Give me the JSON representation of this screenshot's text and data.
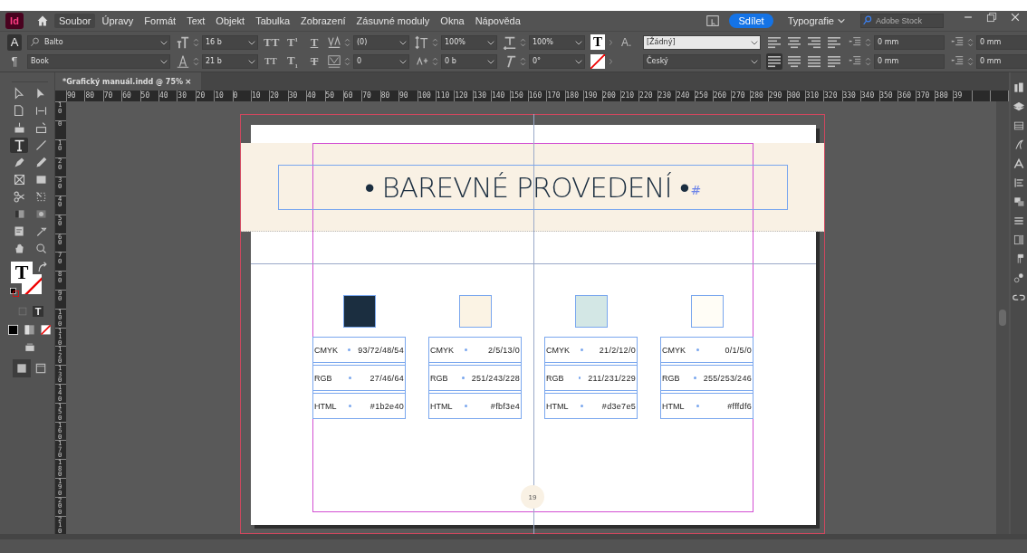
{
  "app": {
    "logo": "Id"
  },
  "menu": [
    {
      "label": "Soubor",
      "selected": true
    },
    {
      "label": "Úpravy",
      "selected": false
    },
    {
      "label": "Formát",
      "selected": false
    },
    {
      "label": "Text",
      "selected": false
    },
    {
      "label": "Objekt",
      "selected": false
    },
    {
      "label": "Tabulka",
      "selected": false
    },
    {
      "label": "Zobrazení",
      "selected": false
    },
    {
      "label": "Zásuvné moduly",
      "selected": false
    },
    {
      "label": "Okna",
      "selected": false
    },
    {
      "label": "Nápověda",
      "selected": false
    }
  ],
  "header_right": {
    "share": "Sdílet",
    "workspace": "Typografie",
    "search_placeholder": "Adobe Stock"
  },
  "control_panel": {
    "modes": [
      {
        "label": "A",
        "selected": true
      },
      {
        "label": "¶",
        "selected": false
      }
    ],
    "font_family": "Balto",
    "font_style": "Book",
    "font_size": "16 b",
    "leading": "21 b",
    "style_rows": [
      [
        {
          "label": "TT",
          "kind": "plain"
        },
        {
          "label": "T$^{1}$",
          "kind": "plain"
        },
        {
          "label": "T",
          "kind": "underline"
        }
      ],
      [
        {
          "label": "TT",
          "kind": "smallcaps"
        },
        {
          "label": "T$_{1}$",
          "kind": "plain"
        },
        {
          "label": "T",
          "kind": "strike"
        }
      ]
    ],
    "fields": [
      [
        {
          "kind": "kerning",
          "value": "(0)"
        },
        {
          "kind": "vscale",
          "value": "100%"
        },
        {
          "kind": "hscale",
          "value": "100%"
        }
      ],
      [
        {
          "kind": "tracking",
          "value": "0"
        },
        {
          "kind": "baseline",
          "value": "0 b"
        },
        {
          "kind": "skew",
          "value": "0°"
        }
      ]
    ],
    "char_style_label": "A.",
    "char_style": "[Žádný]",
    "language": "Český",
    "align": [
      {
        "kind": "left",
        "selected": false
      },
      {
        "kind": "center",
        "selected": false
      },
      {
        "kind": "right",
        "selected": false
      },
      {
        "kind": "towardspine",
        "selected": false
      },
      {
        "kind": "justify-left",
        "selected": true
      },
      {
        "kind": "justify-center",
        "selected": false
      },
      {
        "kind": "justify-all",
        "selected": false
      },
      {
        "kind": "awayspine",
        "selected": false
      }
    ],
    "indents": [
      [
        "0 mm",
        "0 mm"
      ],
      [
        "0 mm",
        "0 mm"
      ]
    ]
  },
  "document_tab": {
    "title": "*Grafický manuál.indd @ 75%",
    "close": "×"
  },
  "ruler_h": [
    "90",
    "80",
    "70",
    "60",
    "50",
    "40",
    "30",
    "20",
    "10",
    "0",
    "10",
    "20",
    "30",
    "40",
    "50",
    "60",
    "70",
    "80",
    "90",
    "100",
    "110",
    "120",
    "130",
    "140",
    "150",
    "160",
    "170",
    "180",
    "190",
    "200",
    "210",
    "220",
    "230",
    "240",
    "250",
    "260",
    "270",
    "280",
    "290",
    "300",
    "310",
    "320",
    "330",
    "340",
    "350",
    "360",
    "370",
    "380",
    "39"
  ],
  "ruler_v": [
    "10",
    "0",
    "10",
    "20",
    "30",
    "40",
    "50",
    "60",
    "70",
    "80",
    "90",
    "100",
    "110",
    "120",
    "130",
    "140",
    "150",
    "160",
    "170",
    "180",
    "190",
    "200",
    "210"
  ],
  "tools": [
    {
      "kind": "select",
      "selected": false
    },
    {
      "kind": "direct",
      "selected": false
    },
    {
      "kind": "page",
      "selected": false
    },
    {
      "kind": "gap",
      "selected": false
    },
    {
      "kind": "collect",
      "selected": false
    },
    {
      "kind": "place",
      "selected": false
    },
    {
      "kind": "type",
      "selected": true
    },
    {
      "kind": "line",
      "selected": false
    },
    {
      "kind": "pen",
      "selected": false
    },
    {
      "kind": "pencil",
      "selected": false
    },
    {
      "kind": "frame",
      "selected": false
    },
    {
      "kind": "rect",
      "selected": false
    },
    {
      "kind": "scissors",
      "selected": false
    },
    {
      "kind": "transform",
      "selected": false
    },
    {
      "kind": "gradient",
      "selected": false
    },
    {
      "kind": "feather",
      "selected": false
    },
    {
      "kind": "note",
      "selected": false
    },
    {
      "kind": "eyedropper",
      "selected": false
    },
    {
      "kind": "hand",
      "selected": false
    },
    {
      "kind": "zoom",
      "selected": false
    }
  ],
  "fill_stroke": {
    "fill_label": "T",
    "toolbox_fill_label": "T",
    "formatting_label": "T"
  },
  "page": {
    "title": "• BAREVNÉ PROVEDENÍ •",
    "end_mark": "#",
    "page_number": "19",
    "swatches": [
      {
        "color": "#1b2e40",
        "rows": [
          {
            "label": "CMYK",
            "value": "93/72/48/54"
          },
          {
            "label": "RGB",
            "value": "27/46/64"
          },
          {
            "label": "HTML",
            "value": "#1b2e40"
          }
        ]
      },
      {
        "color": "#fbf3e4",
        "rows": [
          {
            "label": "CMYK",
            "value": "2/5/13/0"
          },
          {
            "label": "RGB",
            "value": "251/243/228"
          },
          {
            "label": "HTML",
            "value": "#fbf3e4"
          }
        ]
      },
      {
        "color": "#d3e7e5",
        "rows": [
          {
            "label": "CMYK",
            "value": "21/2/12/0"
          },
          {
            "label": "RGB",
            "value": "211/231/229"
          },
          {
            "label": "HTML",
            "value": "#d3e7e5"
          }
        ]
      },
      {
        "color": "#fffdf6",
        "rows": [
          {
            "label": "CMYK",
            "value": "0/1/5/0"
          },
          {
            "label": "RGB",
            "value": "255/253/246"
          },
          {
            "label": "HTML",
            "value": "#fffdf6"
          }
        ]
      }
    ]
  }
}
